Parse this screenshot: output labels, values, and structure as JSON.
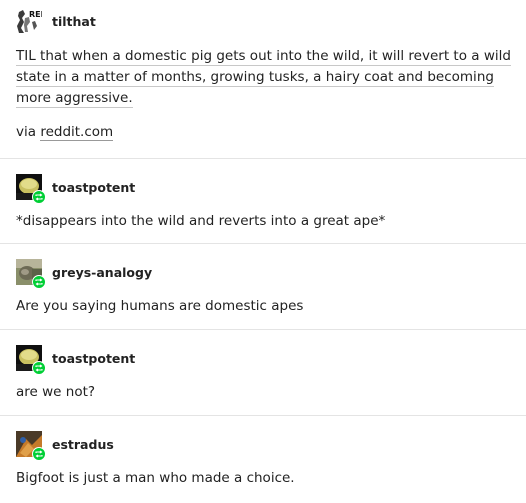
{
  "colors": {
    "text": "#222222",
    "divider": "#e4e4e4",
    "reblog_badge": "#00cf35",
    "link_underline": "#999999"
  },
  "posts": [
    {
      "username": "tilthat",
      "avatar_icon": "reddit-til-avatar-icon",
      "avatar_text": "REI",
      "reblogged": false,
      "text": "TIL that when a domestic pig gets out into the wild, it will revert to a wild state in a matter of months, growing tusks, a hairy coat and becoming more aggressive.",
      "via_prefix": "via ",
      "via_link": "reddit.com"
    },
    {
      "username": "toastpotent",
      "avatar_icon": "toastpotent-avatar-icon",
      "reblogged": true,
      "text": "*disappears into the wild and reverts into a great ape*"
    },
    {
      "username": "greys-analogy",
      "avatar_icon": "greys-analogy-avatar-icon",
      "reblogged": true,
      "text": "Are you saying humans are domestic apes"
    },
    {
      "username": "toastpotent",
      "avatar_icon": "toastpotent-avatar-icon",
      "reblogged": true,
      "text": "are we not?"
    },
    {
      "username": "estradus",
      "avatar_icon": "estradus-avatar-icon",
      "reblogged": true,
      "text": "Bigfoot is just a man who made a choice."
    }
  ]
}
